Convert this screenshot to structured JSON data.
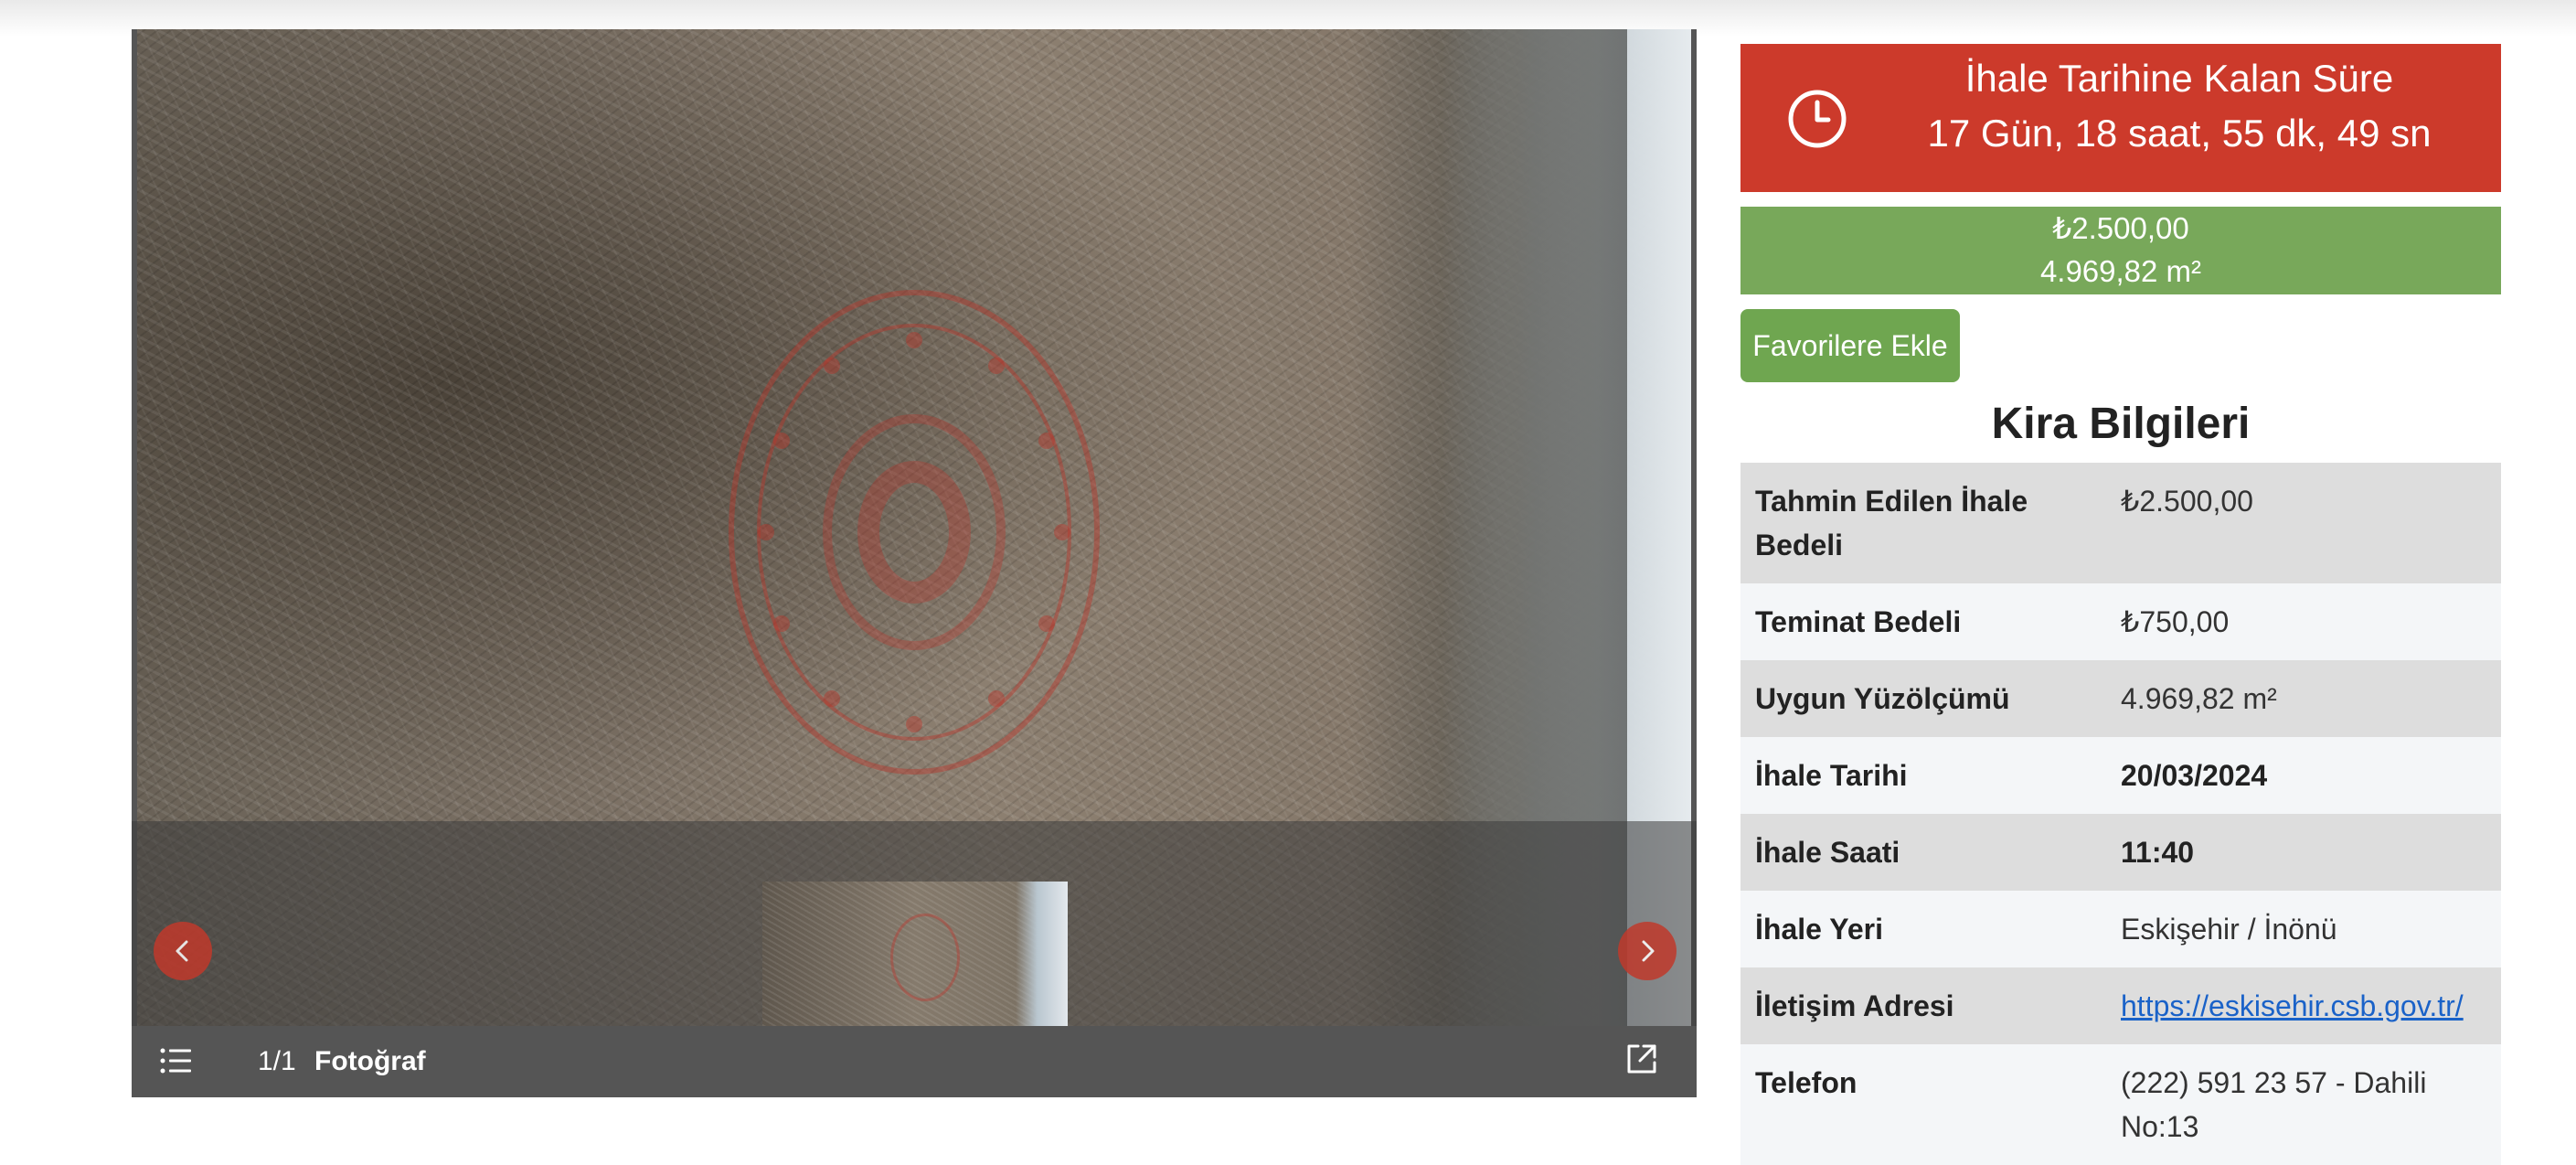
{
  "gallery": {
    "counter": "1/1",
    "photo_label": "Fotoğraf",
    "icons": {
      "prev": "chevron-left-icon",
      "next": "chevron-right-icon",
      "list": "list-icon",
      "fullscreen": "expand-icon"
    }
  },
  "countdown": {
    "title": "İhale Tarihine Kalan Süre",
    "time": "17 Gün, 18 saat, 55 dk, 49 sn",
    "icon": "clock-icon",
    "color": "#cc3a2b"
  },
  "summary": {
    "price": "₺2.500,00",
    "area": "4.969,82 m²",
    "color": "#78a85a"
  },
  "favorite_button": "Favorilere Ekle",
  "section_title": "Kira Bilgileri",
  "info_rows": [
    {
      "label": "Tahmin Edilen İhale Bedeli",
      "value": "₺2.500,00"
    },
    {
      "label": "Teminat Bedeli",
      "value": "₺750,00"
    },
    {
      "label": "Uygun Yüzölçümü",
      "value": "4.969,82 m²"
    },
    {
      "label": "İhale Tarihi",
      "value": "20/03/2024"
    },
    {
      "label": "İhale Saati",
      "value": "11:40"
    },
    {
      "label": "İhale Yeri",
      "value": "Eskişehir / İnönü"
    },
    {
      "label": "İletişim Adresi",
      "value": "https://eskisehir.csb.gov.tr/"
    },
    {
      "label": "Telefon",
      "value": "(222) 591 23 57 - Dahili No:13"
    }
  ]
}
